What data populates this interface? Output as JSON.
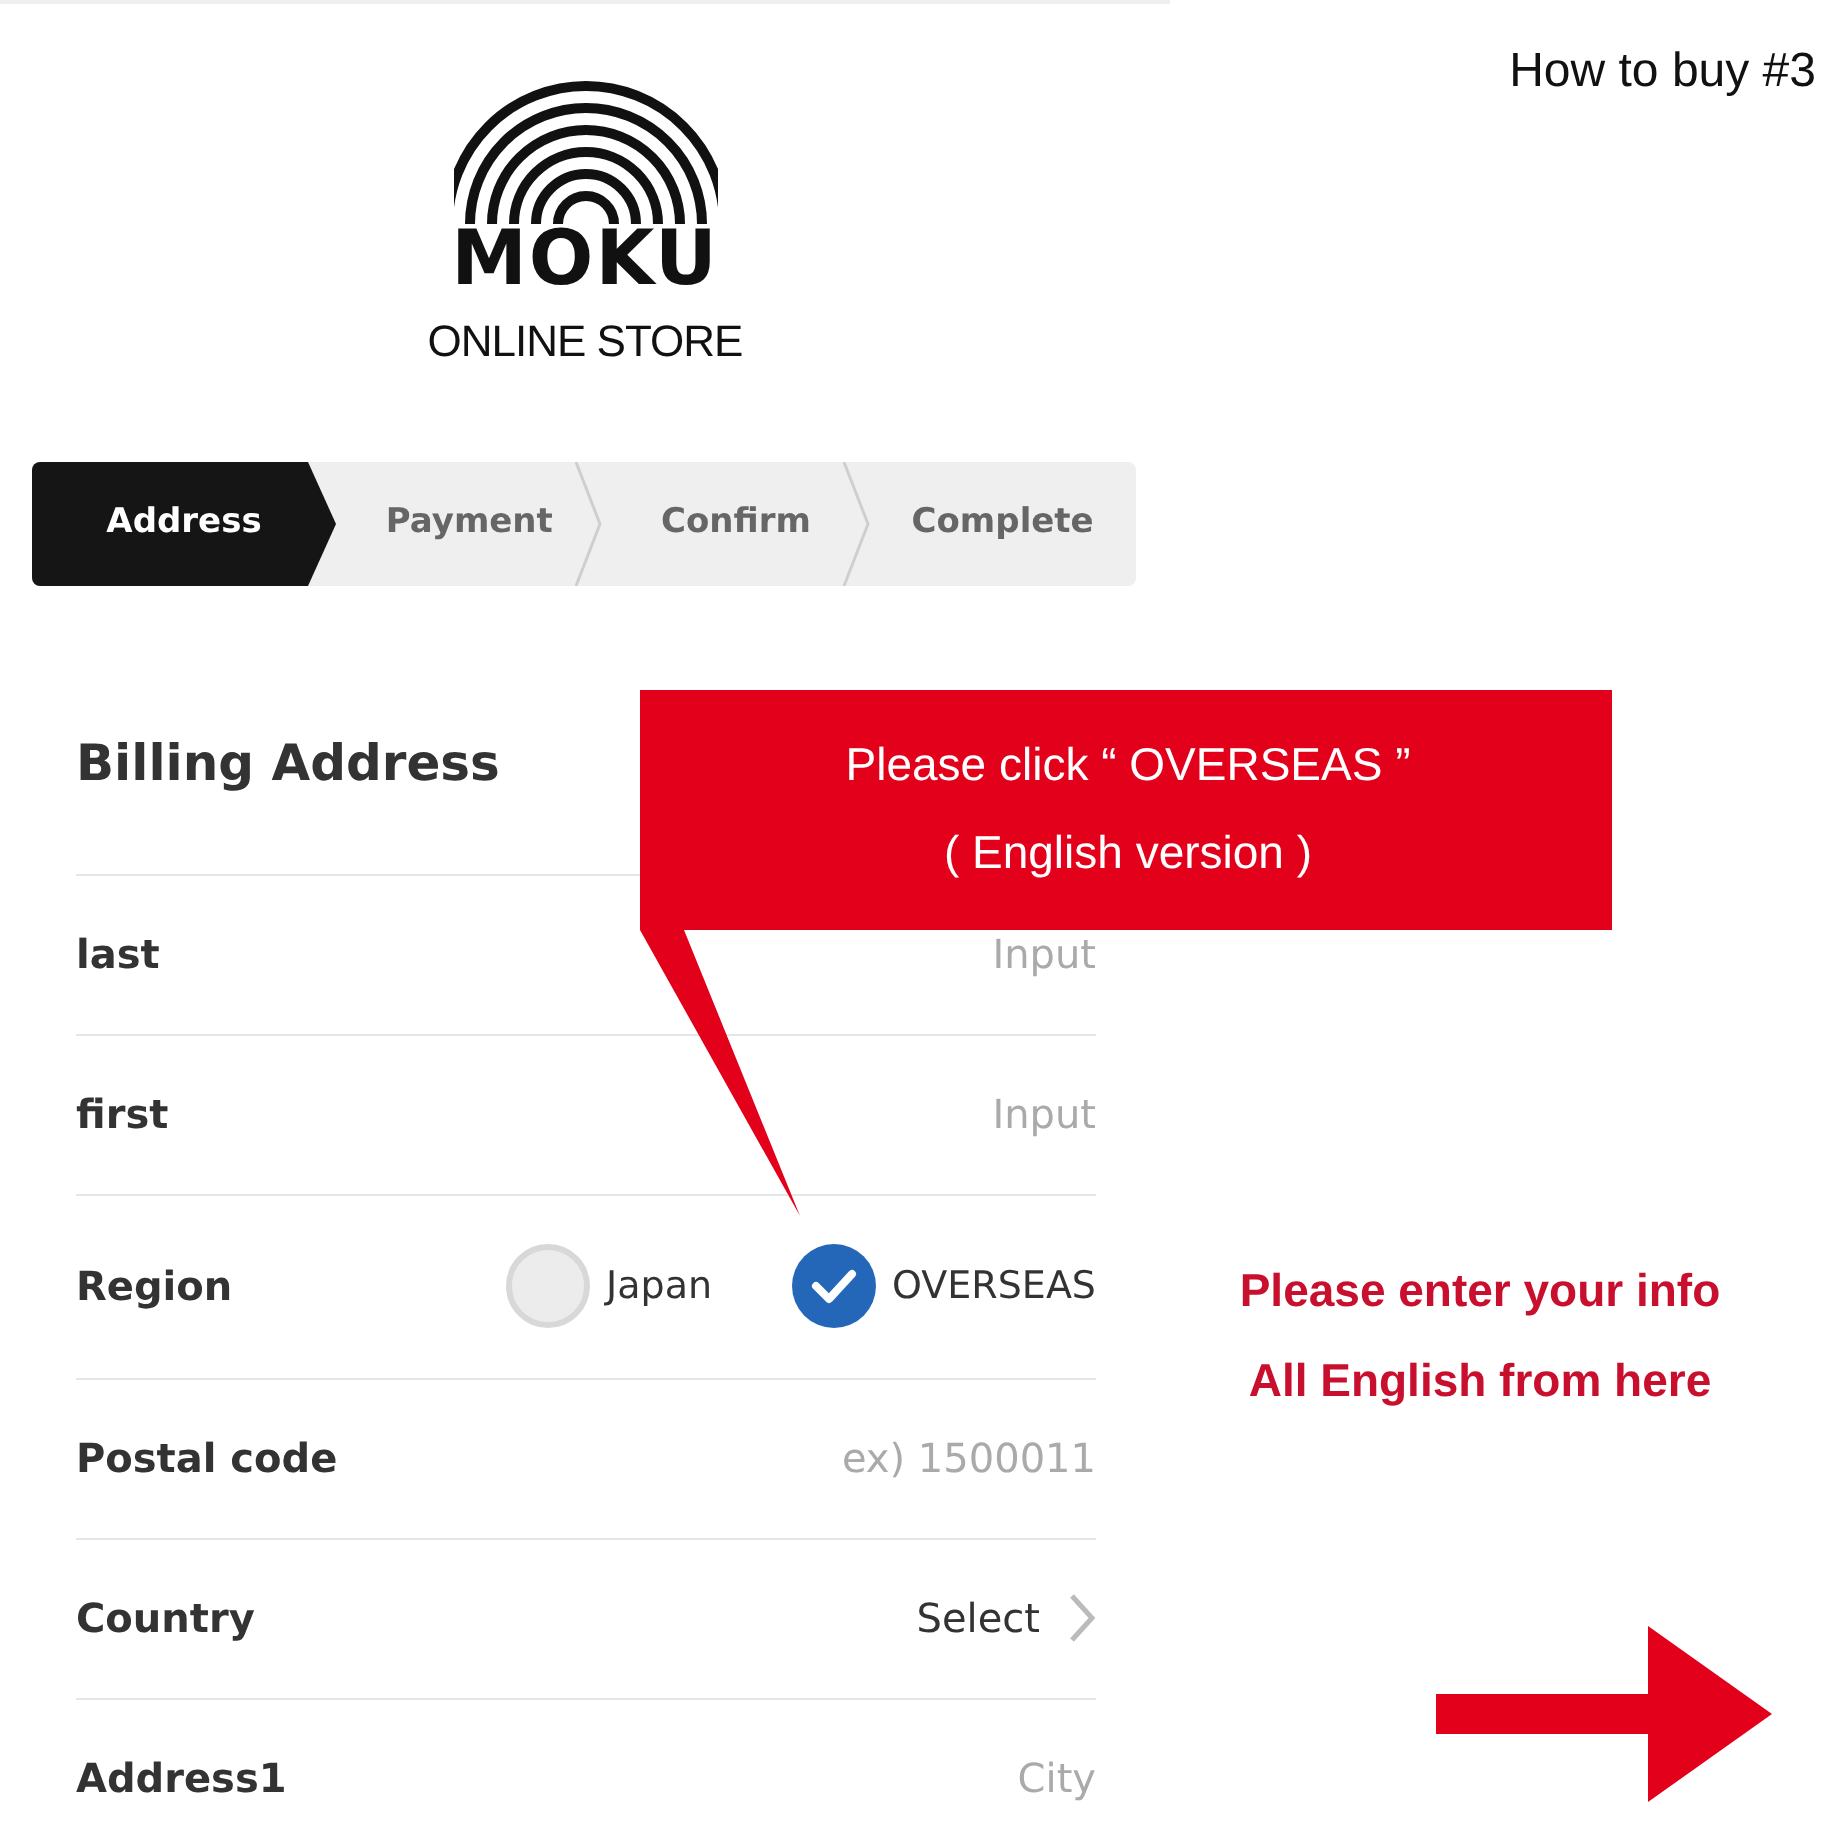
{
  "header": {
    "title": "How to buy #3"
  },
  "logo": {
    "wordmark": "MOKU",
    "subtitle": "ONLINE STORE"
  },
  "steps": [
    {
      "label": "Address",
      "selected": true
    },
    {
      "label": "Payment",
      "selected": false
    },
    {
      "label": "Confirm",
      "selected": false
    },
    {
      "label": "Complete",
      "selected": false
    }
  ],
  "form": {
    "title": "Billing Address",
    "fields": [
      {
        "kind": "text",
        "label": "last",
        "placeholder": "Input"
      },
      {
        "kind": "text",
        "label": "first",
        "placeholder": "Input"
      },
      {
        "kind": "radio",
        "label": "Region",
        "options": [
          {
            "label": "Japan",
            "selected": false
          },
          {
            "label": "OVERSEAS",
            "selected": true
          }
        ]
      },
      {
        "kind": "text",
        "label": "Postal code",
        "placeholder": "ex) 1500011"
      },
      {
        "kind": "select",
        "label": "Country",
        "value": "Select"
      },
      {
        "kind": "text",
        "label": "Address1",
        "placeholder": "City"
      }
    ]
  },
  "annotations": {
    "callout": [
      "Please click “ OVERSEAS ”",
      "( English version )"
    ],
    "note": [
      "Please enter your info",
      "All English from here"
    ]
  }
}
